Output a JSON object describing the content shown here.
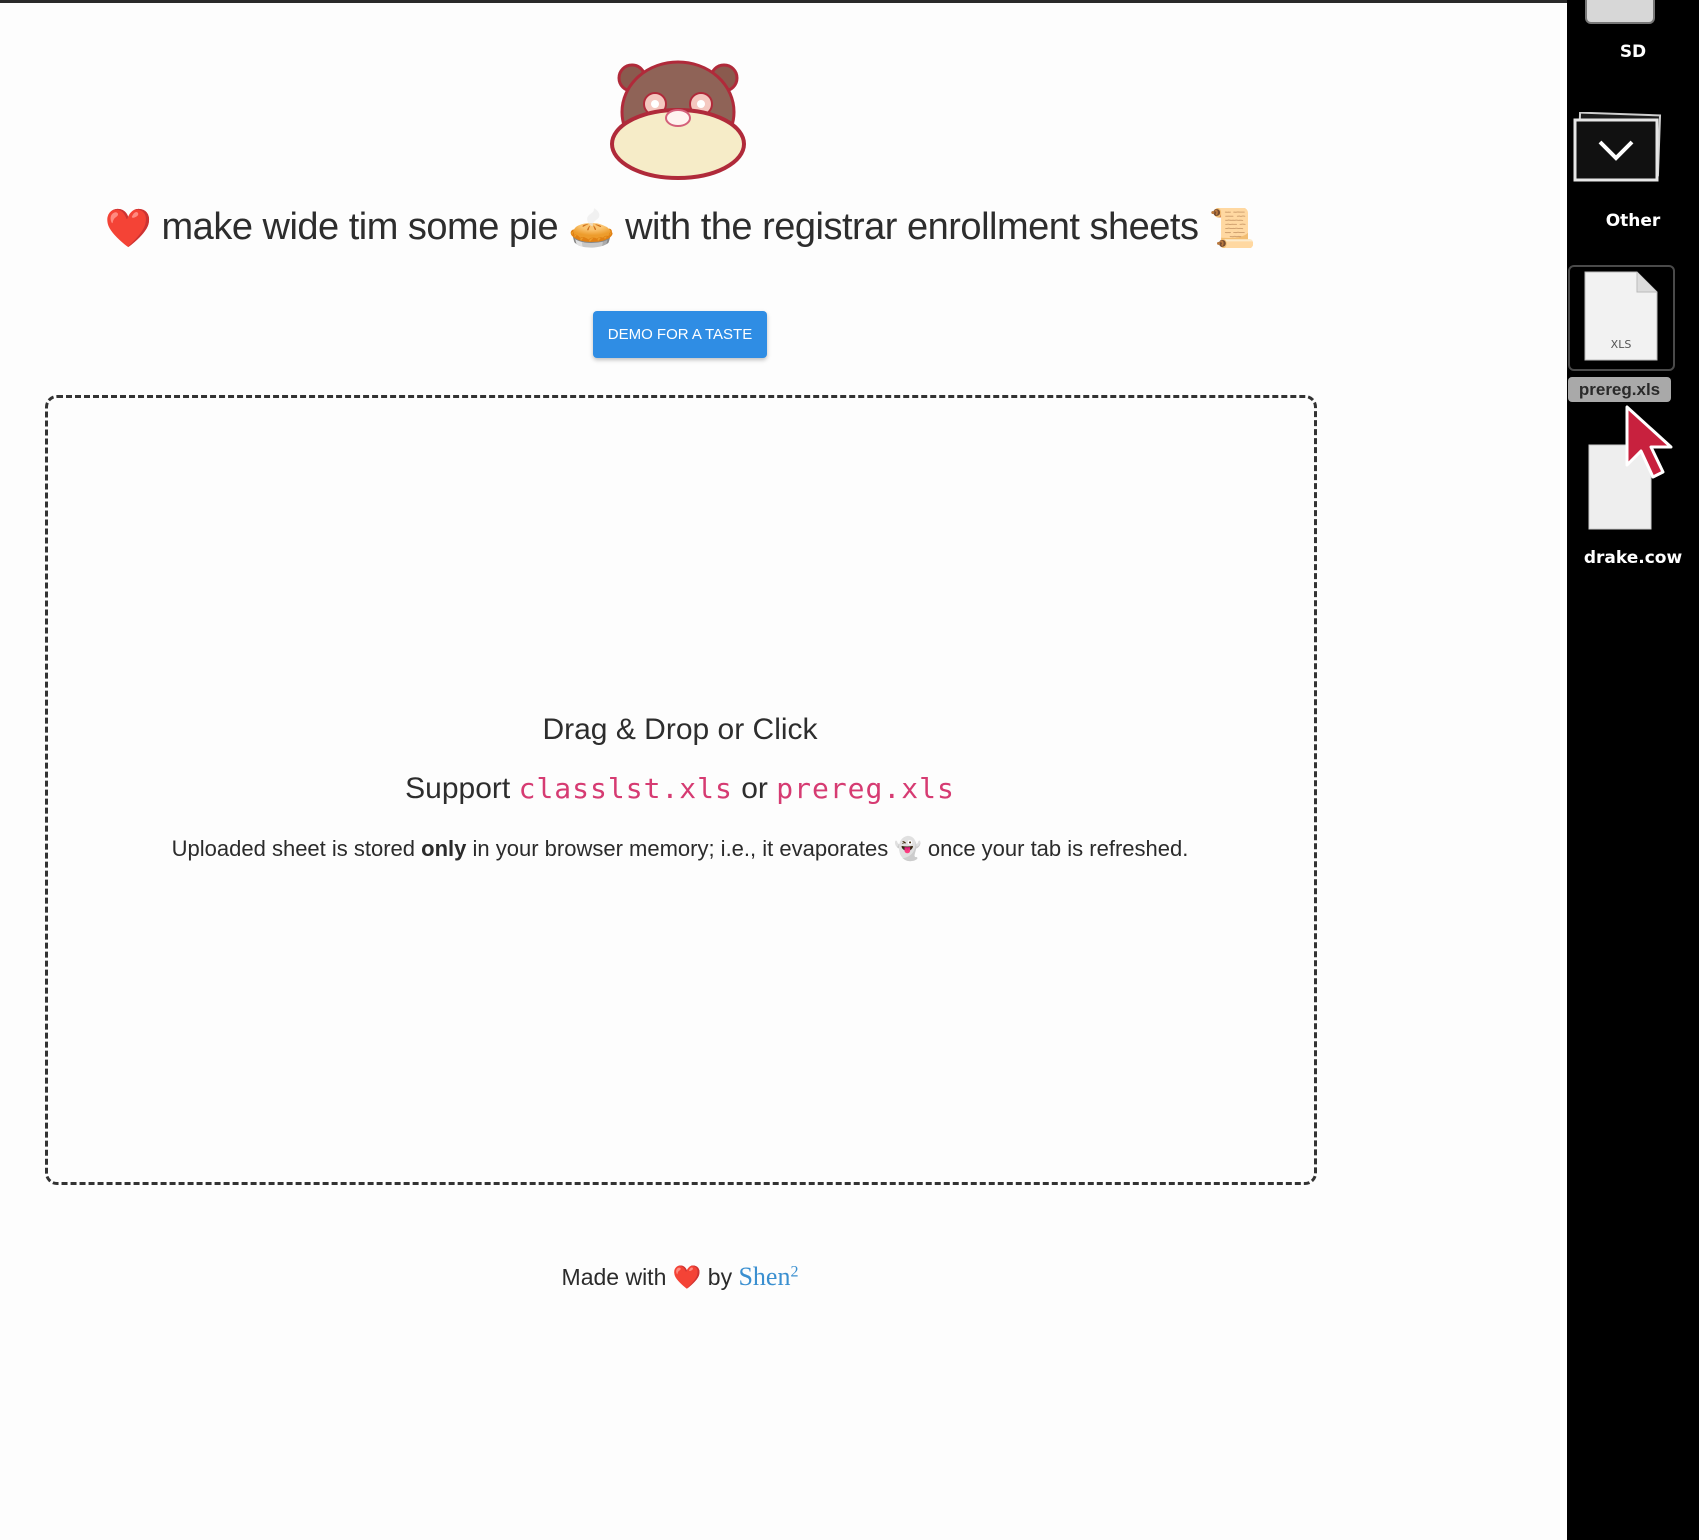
{
  "headline": {
    "heart": "❤️",
    "part1": " make wide tim some pie ",
    "pie": "🥧",
    "part2": " with the registrar enrollment sheets ",
    "scroll": "📜"
  },
  "demo_button": {
    "label": "DEMO FOR A TASTE"
  },
  "dropzone": {
    "title": "Drag & Drop or Click",
    "support_prefix": "Support ",
    "file1": "classlst.xls",
    "or": " or ",
    "file2": "prereg.xls",
    "note_pre": "Uploaded sheet is stored ",
    "note_bold": "only",
    "note_mid": " in your browser memory; i.e., it evaporates ",
    "note_ghost": "👻",
    "note_post": " once your tab is refreshed."
  },
  "footer": {
    "made_with": "Made with ",
    "heart": "❤️",
    "by": " by ",
    "author": "Shen",
    "sup": "2"
  },
  "desktop": {
    "items": [
      {
        "label": "SD",
        "icon": "sd-card-icon"
      },
      {
        "label": "Other",
        "icon": "folder-chevron-icon"
      },
      {
        "label": "prereg.xls",
        "icon": "xls-file-icon",
        "badge": "XLS",
        "selected": true
      },
      {
        "label": "drake.cow",
        "icon": "blank-file-icon"
      }
    ]
  },
  "colors": {
    "button": "#2f8de4",
    "code": "#d63b72",
    "link": "#3a8fd0",
    "desktop_bg": "#000000",
    "cursor": "#c8213e"
  }
}
